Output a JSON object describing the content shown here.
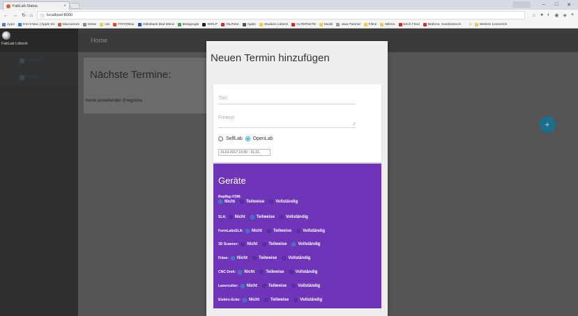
{
  "browser": {
    "tab_title": "FabLab Status",
    "tab_close": "×",
    "url": "localhost:8000",
    "window_controls": [
      "–",
      "□",
      "✕"
    ],
    "bookmarks": [
      {
        "label": "Apps",
        "color": "#4a7ad9"
      },
      {
        "label": "9 to 5 Mac | Apple Int",
        "color": "#3a7cd3"
      },
      {
        "label": "Macrumors",
        "color": "#d35c2a"
      },
      {
        "label": "Heise",
        "color": "#888888"
      },
      {
        "label": "Uni",
        "color": "#f2c84b"
      },
      {
        "label": "FRITZ!Box",
        "color": "#d84a2a"
      },
      {
        "label": "Volksbank Bad Münd",
        "color": "#1f57a6"
      },
      {
        "label": "9to5google",
        "color": "#3aa84a"
      },
      {
        "label": "IMSLP",
        "color": "#222222"
      },
      {
        "label": "YouTube",
        "color": "#d82a2a"
      },
      {
        "label": "Apple",
        "color": "#555555"
      },
      {
        "label": "Studium Lübeck",
        "color": "#f2c84b"
      },
      {
        "label": "ALTERNATE",
        "color": "#c52a2a"
      },
      {
        "label": "Musik",
        "color": "#f2c84b"
      },
      {
        "label": "Java Tutorial",
        "color": "#999999"
      },
      {
        "label": "Filme",
        "color": "#f2c84b"
      },
      {
        "label": "Mikros",
        "color": "#f2c84b"
      },
      {
        "label": "Erich Fried",
        "color": "#c52a2a"
      },
      {
        "label": "Brahms, Sandmännch",
        "color": "#d82a2a"
      },
      {
        "label": "»",
        "color": "transparent"
      },
      {
        "label": "Weitere Lesezeich",
        "color": "#f2c84b"
      }
    ]
  },
  "sidebar": {
    "brand": "FabLab Lübeck",
    "items": [
      {
        "label": "Übersicht"
      },
      {
        "label": "Benutzer"
      }
    ]
  },
  "main": {
    "topbar_title": "Home",
    "card_title": "Nächste Termine:",
    "card_empty": "Keine anstehenden Ereignisse",
    "fab_label": "+"
  },
  "modal": {
    "title": "Neuen Termin hinzufügen",
    "title_placeholder": "Titel",
    "freetext_placeholder": "Freitext",
    "mode_options": [
      {
        "label": "SelfLab",
        "selected": false
      },
      {
        "label": "OpenLab",
        "selected": true
      }
    ],
    "date_range": "31.01.2017 15:00 - 31.01.",
    "devices_heading": "Geräte",
    "state_labels": [
      "Nicht",
      "Teilweise",
      "Vollständig"
    ],
    "devices": [
      {
        "name": "RepRap FDM:",
        "selected": "Nicht"
      },
      {
        "name": "SLA:",
        "selected": "Teilweise"
      },
      {
        "name": "FormLabsSLA:",
        "selected": "Nicht"
      },
      {
        "name": "3D Scanner:",
        "selected": "Vollständig"
      },
      {
        "name": "Fräse:",
        "selected": "Nicht"
      },
      {
        "name": "CNC Dreh:",
        "selected": "Nicht"
      },
      {
        "name": "Lasercutter:",
        "selected": "Nicht"
      },
      {
        "name": "Elektro-Ecke:",
        "selected": "Nicht"
      }
    ]
  }
}
